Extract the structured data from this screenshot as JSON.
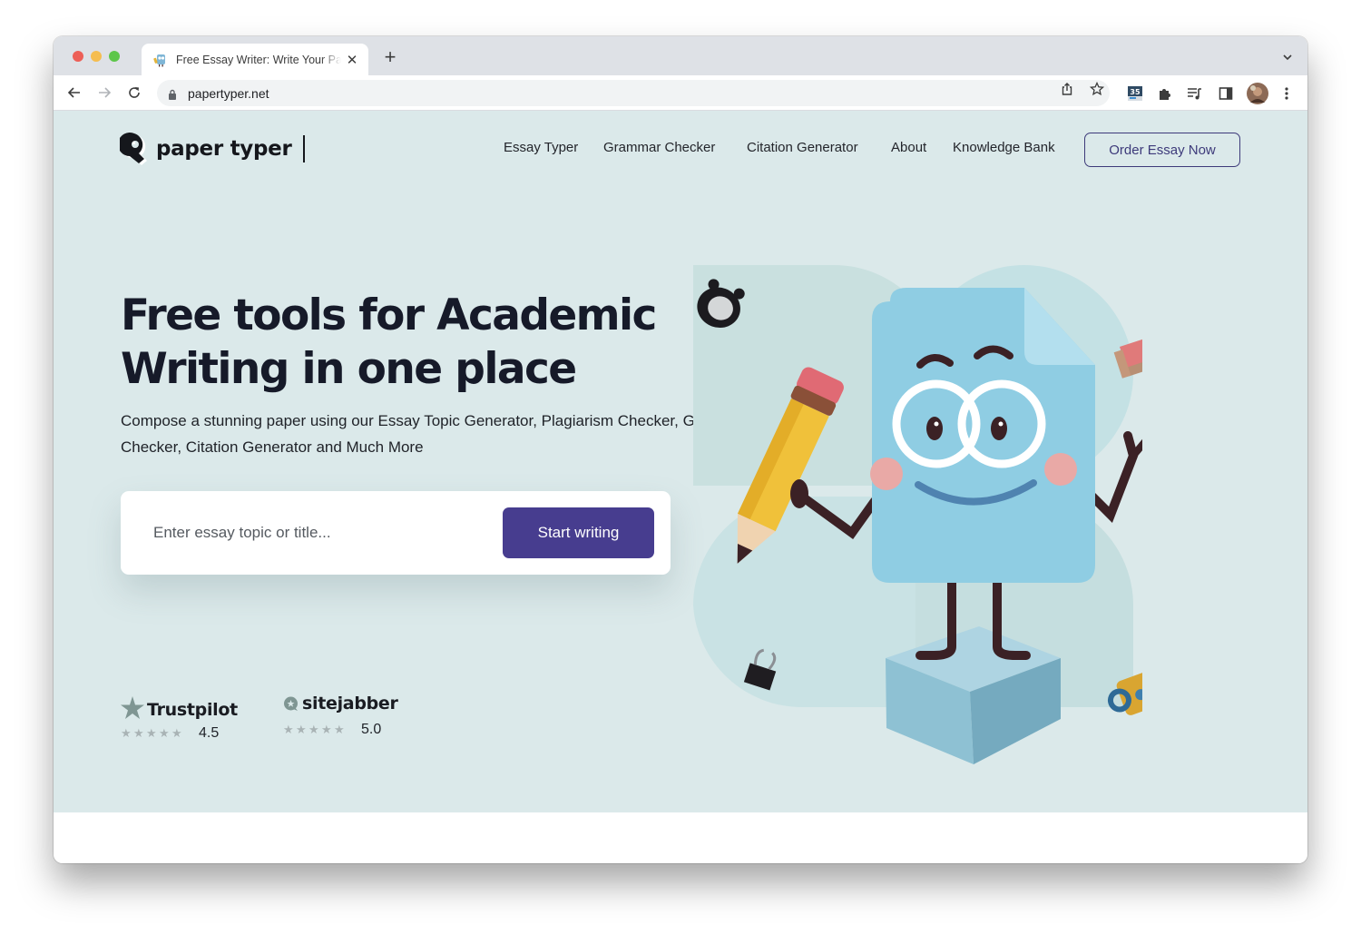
{
  "browser": {
    "tab": {
      "title": "Free Essay Writer: Write Your Papers Fast",
      "favicon": "paper-typer-mascot-icon"
    },
    "new_tab_label": "+",
    "address_bar": {
      "url": "papertyper.net",
      "secure_icon": "lock-icon"
    },
    "toolbar_icons": [
      "back-icon",
      "forward-icon",
      "reload-icon",
      "share-icon",
      "bookmark-star-icon",
      "calendar-extension-icon",
      "puzzle-extensions-icon",
      "media-queue-icon",
      "side-panel-icon",
      "profile-avatar",
      "more-menu-icon"
    ],
    "calendar_badge": "35"
  },
  "site": {
    "logo_text": "paper typer",
    "nav": [
      {
        "label": "Essay Typer"
      },
      {
        "label": "Grammar Checker"
      },
      {
        "label": "Citation Generator"
      },
      {
        "label": "About"
      },
      {
        "label": "Knowledge Bank"
      }
    ],
    "cta_label": "Order Essay Now",
    "hero": {
      "headline_line1": "Free tools for Academic",
      "headline_line2": "Writing in one place",
      "subtext": "Compose a stunning paper using our Essay Topic Generator, Plagiarism Checker, Grammar Checker, Citation Generator and Much More",
      "search_placeholder": "Enter essay topic or title...",
      "search_value": "",
      "start_label": "Start writing"
    },
    "ratings": [
      {
        "brand": "Trustpilot",
        "stars": 5,
        "score": "4.5"
      },
      {
        "brand": "sitejabber",
        "stars": 5,
        "score": "5.0"
      }
    ],
    "colors": {
      "hero_bg": "#dbe9ea",
      "accent": "#473d8f",
      "cta_border": "#3d3a7a",
      "text_dark": "#161a29"
    }
  }
}
